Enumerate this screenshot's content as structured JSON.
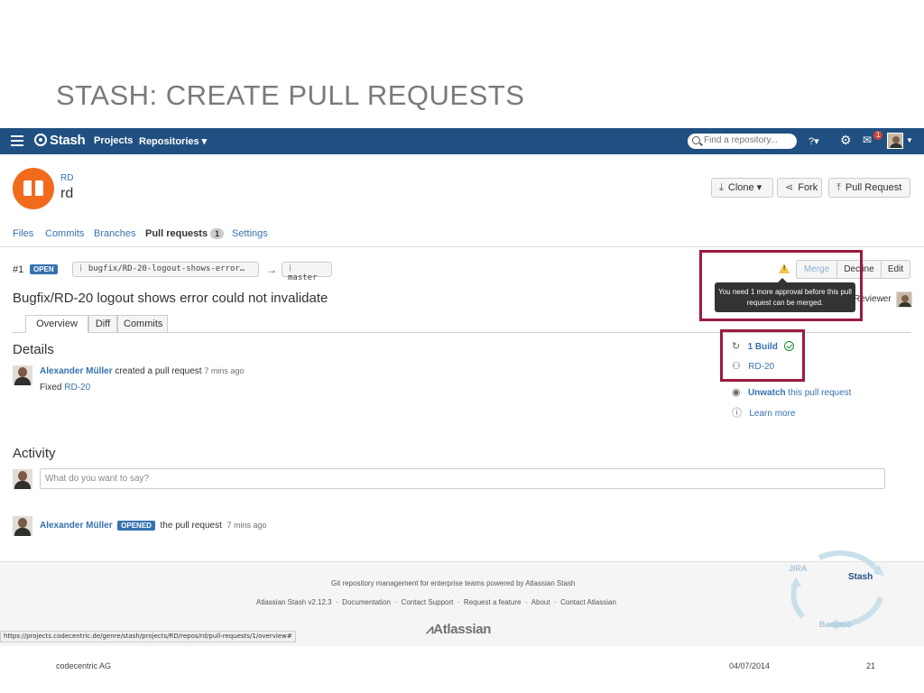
{
  "slide": {
    "title": "STASH: CREATE PULL REQUESTS",
    "company": "codecentric AG",
    "date": "04/07/2014",
    "page": "21"
  },
  "topnav": {
    "logo": "Stash",
    "projects": "Projects",
    "repositories": "Repositories ▾",
    "search_placeholder": "Find a repository...",
    "help": "?▾",
    "notification_count": "1"
  },
  "repo": {
    "project": "RD",
    "name": "rd",
    "clone_label": "Clone ▾",
    "fork_label": "Fork",
    "pull_request_label": "Pull Request"
  },
  "repo_tabs": {
    "files": "Files",
    "commits": "Commits",
    "branches": "Branches",
    "pull_requests": "Pull requests",
    "pull_requests_count": "1",
    "settings": "Settings"
  },
  "pr": {
    "number": "#1",
    "state": "OPEN",
    "source_branch": "bugfix/RD-20-logout-shows-error…",
    "target_branch": "master",
    "title": "Bugfix/RD-20 logout shows error could not invalidate",
    "tabs": [
      "Overview",
      "Diff",
      "Commits"
    ],
    "merge_label": "Merge",
    "decline_label": "Decline",
    "edit_label": "Edit",
    "tooltip": "You need 1 more approval before this pull request can be merged.",
    "reviewer_label": "Reviewer"
  },
  "details": {
    "heading": "Details",
    "author": "Alexander Müller",
    "action": "created a pull request",
    "time": "7 mins ago",
    "fixed_label": "Fixed",
    "fixed_issue": "RD-20"
  },
  "sidebar": {
    "build_label": "1 Build",
    "issue_label": "RD-20",
    "unwatch_label": "Unwatch",
    "unwatch_suffix": "this pull request",
    "learn_more": "Learn more"
  },
  "activity": {
    "heading": "Activity",
    "comment_placeholder": "What do you want to say?",
    "author": "Alexander Müller",
    "state": "OPENED",
    "action": "the pull request",
    "time": "7 mins ago"
  },
  "footer": {
    "tagline": "Git repository management for enterprise teams powered by Atlassian Stash",
    "version": "Atlassian Stash v2.12.3",
    "documentation": "Documentation",
    "contact_support": "Contact Support",
    "request_feature": "Request a feature",
    "about": "About",
    "contact_atlassian": "Contact Atlassian",
    "brand": "Atlassian",
    "status_url": "https://projects.codecentric.de/genre/stash/projects/RD/repos/rd/pull-requests/1/overview#"
  },
  "cycle": {
    "jira": "JIRA",
    "stash": "Stash",
    "bamboo": "Bamboo"
  },
  "colors": {
    "nav": "#205081",
    "link": "#3572b0",
    "highlight": "#9b1b3e",
    "repo_avatar": "#f26b1d"
  }
}
